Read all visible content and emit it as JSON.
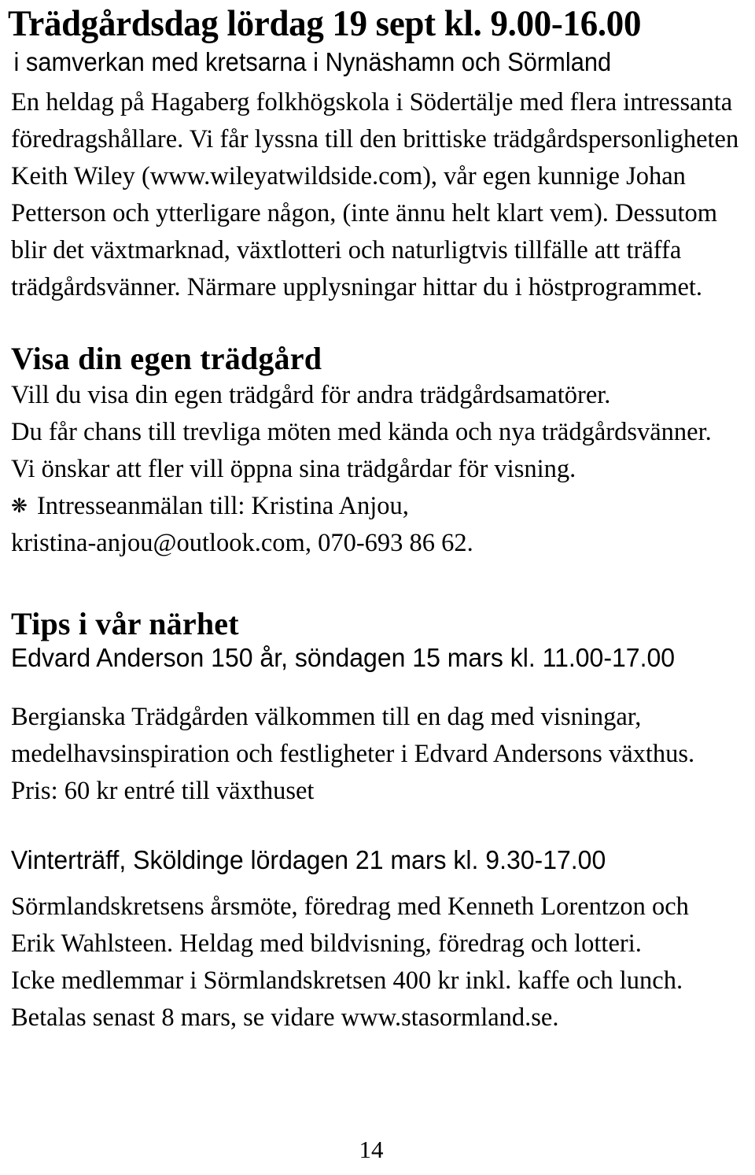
{
  "page": {
    "number": "14",
    "language": "sv"
  },
  "masthead": {
    "title": "Trädgårdsdag lördag 19 sept kl. 9.00-16.00",
    "subtitle": "i samverkan med kretsarna i Nynäshamn och Sörmland"
  },
  "intro": {
    "lines": [
      "En heldag på Hagaberg folkhögskola i Södertälje med flera intressanta",
      "föredragshållare. Vi får lyssna till den brittiske trädgårdspersonligheten",
      "Keith Wiley (www.wileyatwildside.com), vår egen kunnige Johan",
      "Petterson och ytterligare någon, (inte ännu helt klart vem). Dessutom",
      "blir det växtmarknad, växtlotteri och naturligtvis tillfälle att träffa",
      "trädgårdsvänner. Närmare upplysningar hittar du i höstprogrammet."
    ]
  },
  "section_visa": {
    "heading": "Visa din egen trädgård",
    "lines": [
      "Vill du visa din egen trädgård för andra trädgårdsamatörer.",
      "Du får chans till trevliga möten med kända och nya trädgårdsvänner.",
      "Vi önskar att fler vill öppna sina trädgårdar för visning."
    ],
    "bullet_icon": "flower-asterisk",
    "bullet_glyph": "❋",
    "contact_line_1": "Intresseanmälan till: Kristina Anjou,",
    "contact_line_2": "kristina-anjou@outlook.com, 070-693 86 62."
  },
  "section_tips": {
    "heading": "Tips i vår närhet",
    "event_1": {
      "subheading": "Edvard Anderson 150 år, söndagen 15 mars kl. 11.00-17.00",
      "lines": [
        "Bergianska Trädgården välkommen till en dag med visningar,",
        "medelhavsinspiration och festligheter i Edvard Andersons växthus.",
        "Pris: 60 kr entré till växthuset"
      ]
    },
    "event_2": {
      "subheading": "Vinterträff, Sköldinge lördagen 21 mars kl. 9.30-17.00",
      "lines": [
        "Sörmlandskretsens årsmöte, föredrag med Kenneth Lorentzon och",
        "Erik Wahlsteen. Heldag med bildvisning, föredrag och lotteri.",
        "Icke medlemmar i Sörmlandskretsen 400 kr inkl. kaffe och lunch.",
        "Betalas senast 8 mars, se vidare www.stasormland.se."
      ]
    }
  },
  "colors": {
    "text": "#000000",
    "background": "#ffffff"
  }
}
